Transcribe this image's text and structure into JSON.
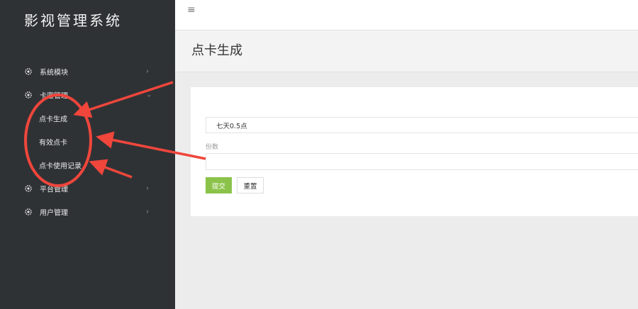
{
  "app": {
    "title": "影视管理系统"
  },
  "sidebar": {
    "items": [
      {
        "label": "系统模块",
        "icon": "gear-icon",
        "expanded": false
      },
      {
        "label": "卡密管理",
        "icon": "gear-icon",
        "expanded": true,
        "children": [
          {
            "label": "点卡生成"
          },
          {
            "label": "有效点卡"
          },
          {
            "label": "点卡使用记录"
          }
        ]
      },
      {
        "label": "平台管理",
        "icon": "gear-icon",
        "expanded": false
      },
      {
        "label": "用户管理",
        "icon": "gear-icon",
        "expanded": false
      }
    ]
  },
  "topbar": {
    "menu_icon": "hamburger-icon"
  },
  "page": {
    "title": "点卡生成"
  },
  "form": {
    "type_select": {
      "value": "七天0.5点"
    },
    "count_label": "份数",
    "count_value": "",
    "submit_label": "提交",
    "reset_label": "重置"
  },
  "colors": {
    "sidebar_bg": "#2f3235",
    "submit_green": "#8bc34a",
    "annotation_red": "#f0463c"
  }
}
